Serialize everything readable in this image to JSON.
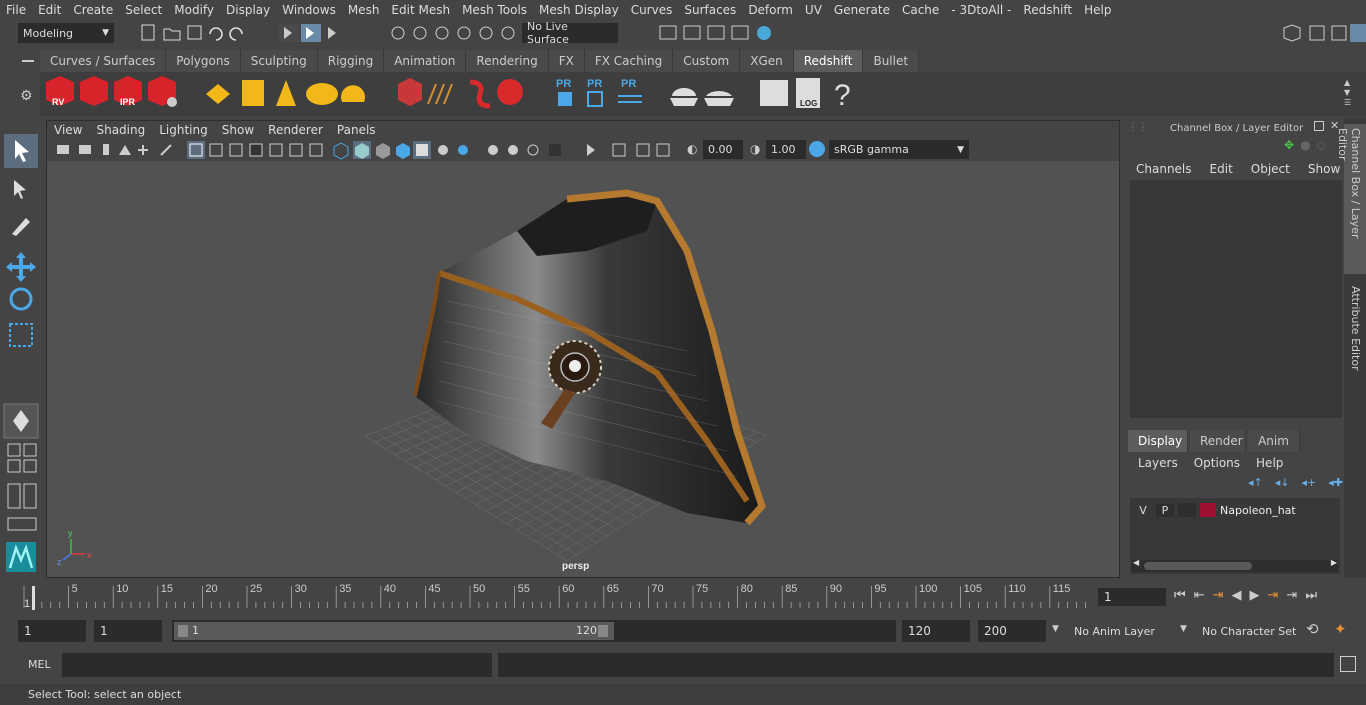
{
  "menubar": [
    "File",
    "Edit",
    "Create",
    "Select",
    "Modify",
    "Display",
    "Windows",
    "Mesh",
    "Edit Mesh",
    "Mesh Tools",
    "Mesh Display",
    "Curves",
    "Surfaces",
    "Deform",
    "UV",
    "Generate",
    "Cache",
    "- 3DtoAll -",
    "Redshift",
    "Help"
  ],
  "status": {
    "mode": "Modeling",
    "live_surface": "No Live Surface"
  },
  "shelf_tabs": [
    "Curves / Surfaces",
    "Polygons",
    "Sculpting",
    "Rigging",
    "Animation",
    "Rendering",
    "FX",
    "FX Caching",
    "Custom",
    "XGen",
    "Redshift",
    "Bullet"
  ],
  "shelf_active": "Redshift",
  "shelf_labels": {
    "rv": "RV",
    "ipr": "IPR",
    "pr1": "PR",
    "pr2": "PR",
    "pr3": "PR",
    "log": "LOG",
    "help": "?"
  },
  "viewport": {
    "menu": [
      "View",
      "Shading",
      "Lighting",
      "Show",
      "Renderer",
      "Panels"
    ],
    "exposure": "0.00",
    "gamma": "1.00",
    "colorspace": "sRGB gamma",
    "camera_label": "persp",
    "axis": {
      "x": "x",
      "y": "y",
      "z": "z"
    }
  },
  "channel_box": {
    "title": "Channel Box / Layer Editor",
    "menu": [
      "Channels",
      "Edit",
      "Object",
      "Show"
    ],
    "layer_tabs": [
      "Display",
      "Render",
      "Anim"
    ],
    "layer_active": "Display",
    "layer_menu": [
      "Layers",
      "Options",
      "Help"
    ],
    "layer": {
      "v": "V",
      "p": "P",
      "name": "Napoleon_hat",
      "color": "#a01030"
    }
  },
  "side_tabs": {
    "channel": "Channel Box / Layer Editor",
    "attribute": "Attribute Editor"
  },
  "timeline": {
    "ticks": [
      "5",
      "10",
      "15",
      "20",
      "25",
      "30",
      "35",
      "40",
      "45",
      "50",
      "55",
      "60",
      "65",
      "70",
      "75",
      "80",
      "85",
      "90",
      "95",
      "100",
      "105",
      "110",
      "115",
      "12"
    ],
    "start_mark": "1",
    "current_frame": "1"
  },
  "range": {
    "start": "1",
    "playback_start": "1",
    "slider_start": "1",
    "slider_end": "120",
    "playback_end": "120",
    "end": "200",
    "anim_layer": "No Anim Layer",
    "character_set": "No Character Set"
  },
  "cmdline": {
    "lang": "MEL"
  },
  "help_text": "Select Tool: select an object"
}
